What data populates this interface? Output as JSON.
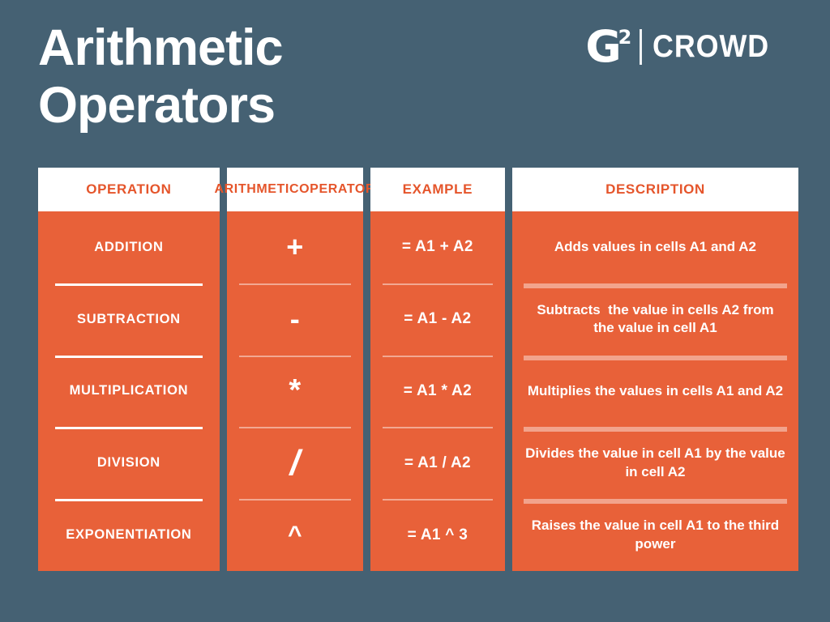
{
  "page": {
    "background_color": "#456173",
    "accent_color": "#e86139",
    "accent_text_color": "#e5552b",
    "title_line_1": "Arithmetic",
    "title_line_2": "Operators"
  },
  "logo": {
    "mark": "G",
    "superscript": "2",
    "wordmark": "CROWD"
  },
  "table": {
    "headers": [
      {
        "label": "OPERATION"
      },
      {
        "label_line_1": "ARITHMETIC",
        "label_line_2": "OPERATOR"
      },
      {
        "label": "EXAMPLE"
      },
      {
        "label": "DESCRIPTION"
      }
    ],
    "rows": [
      {
        "operation": "ADDITION",
        "operator": "+",
        "example": "= A1 + A2",
        "description": "Adds values in cells A1 and A2"
      },
      {
        "operation": "SUBTRACTION",
        "operator": "-",
        "example": "= A1 - A2",
        "description": "Subtracts  the value in cells A2 from the value in cell A1"
      },
      {
        "operation": "MULTIPLICATION",
        "operator": "*",
        "example": "= A1 * A2",
        "description": "Multiplies the values in cells A1 and A2"
      },
      {
        "operation": "DIVISION",
        "operator": "/",
        "example": "= A1 / A2",
        "description": "Divides the value in cell A1 by the value in cell A2"
      },
      {
        "operation": "EXPONENTIATION",
        "operator": "^",
        "example": "= A1 ^ 3",
        "description": "Raises the value in cell A1 to the third power"
      }
    ]
  }
}
